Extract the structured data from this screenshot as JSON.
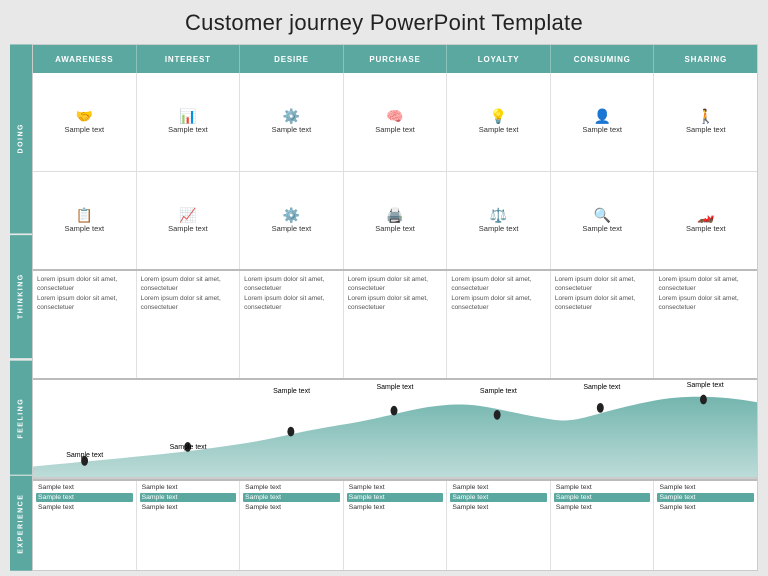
{
  "title": "Customer journey PowerPoint Template",
  "columns": [
    "AWARENESS",
    "INTEREST",
    "DESIRE",
    "PURCHASE",
    "LOYALTY",
    "CONSUMING",
    "SHARING"
  ],
  "rowLabels": [
    "DOING",
    "THINKING",
    "FEELING",
    "EXPERIENCE"
  ],
  "doing": {
    "row1": {
      "icons": [
        "🤝",
        "📊",
        "⚙️",
        "🧠",
        "💡",
        "👤",
        "🚶"
      ],
      "texts": [
        "Sample text",
        "Sample text",
        "Sample text",
        "Sample text",
        "Sample text",
        "Sample text",
        "Sample text"
      ]
    },
    "row2": {
      "icons": [
        "📋",
        "📈",
        "⚙️",
        "🖨️",
        "⚖️",
        "🔍",
        "🏎️"
      ],
      "texts": [
        "Sample text",
        "Sample text",
        "Sample text",
        "Sample text",
        "Sample text",
        "Sample text",
        "Sample text"
      ]
    }
  },
  "thinking": {
    "line1": "Lorem ipsum dolor sit amet, consectetuer",
    "line2": "Lorem ipsum dolor sit amet, consectetuer"
  },
  "feeling": {
    "texts": [
      "Sample text",
      "Sample text",
      "Sample text",
      "Sample text",
      "Sample text",
      "Sample text",
      "Sample text"
    ]
  },
  "experience": {
    "rows": [
      [
        "Sample text",
        "Sample text",
        "Sample text",
        "Sample text",
        "Sample text",
        "Sample text",
        "Sample text"
      ],
      [
        "Sample text",
        "Sample text",
        "Sample text",
        "Sample text",
        "Sample text",
        "Sample text",
        "Sample text"
      ],
      [
        "Sample text",
        "Sample text",
        "Sample text",
        "Sample text",
        "Sample text",
        "Sample text",
        "Sample text"
      ]
    ],
    "highlights": [
      1,
      1,
      1,
      1,
      1,
      1,
      1
    ]
  },
  "colors": {
    "accent": "#5ba8a0",
    "headerText": "#ffffff",
    "bodyText": "#333333",
    "lightText": "#555555",
    "bg": "#ffffff"
  }
}
